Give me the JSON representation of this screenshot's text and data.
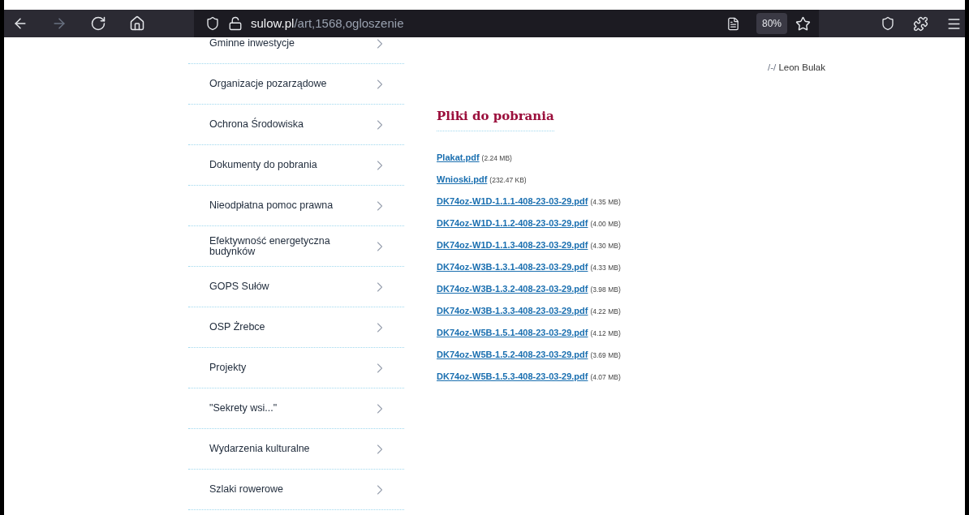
{
  "toolbar": {
    "url_host": "sulow.pl",
    "url_path": "/art,1568,ogloszenie",
    "zoom": "80%"
  },
  "sidebar": {
    "items": [
      {
        "label": "Gminne inwestycje"
      },
      {
        "label": "Organizacje pozarządowe"
      },
      {
        "label": "Ochrona Środowiska"
      },
      {
        "label": "Dokumenty do pobrania"
      },
      {
        "label": "Nieodpłatna pomoc prawna"
      },
      {
        "label": "Efektywność energetyczna budynków"
      },
      {
        "label": "GOPS Sułów"
      },
      {
        "label": "OSP Żrebce"
      },
      {
        "label": "Projekty"
      },
      {
        "label": "\"Sekrety wsi...\""
      },
      {
        "label": "Wydarzenia kulturalne"
      },
      {
        "label": "Szlaki rowerowe"
      }
    ]
  },
  "signature": {
    "prefix": "/-/",
    "name": "Leon Bulak"
  },
  "downloads": {
    "title": "Pliki do pobrania",
    "files": [
      {
        "name": "Plakat.pdf",
        "size": "(2.24 MB)"
      },
      {
        "name": "Wnioski.pdf",
        "size": "(232.47 KB)"
      },
      {
        "name": "DK74oz-W1D-1.1.1-408-23-03-29.pdf",
        "size": "(4.35 MB)"
      },
      {
        "name": "DK74oz-W1D-1.1.2-408-23-03-29.pdf",
        "size": "(4.00 MB)"
      },
      {
        "name": "DK74oz-W1D-1.1.3-408-23-03-29.pdf",
        "size": "(4.30 MB)"
      },
      {
        "name": "DK74oz-W3B-1.3.1-408-23-03-29.pdf",
        "size": "(4.33 MB)"
      },
      {
        "name": "DK74oz-W3B-1.3.2-408-23-03-29.pdf",
        "size": "(3.98 MB)"
      },
      {
        "name": "DK74oz-W3B-1.3.3-408-23-03-29.pdf",
        "size": "(4.22 MB)"
      },
      {
        "name": "DK74oz-W5B-1.5.1-408-23-03-29.pdf",
        "size": "(4.12 MB)"
      },
      {
        "name": "DK74oz-W5B-1.5.2-408-23-03-29.pdf",
        "size": "(3.69 MB)"
      },
      {
        "name": "DK74oz-W5B-1.5.3-408-23-03-29.pdf",
        "size": "(4.07 MB)"
      }
    ]
  }
}
